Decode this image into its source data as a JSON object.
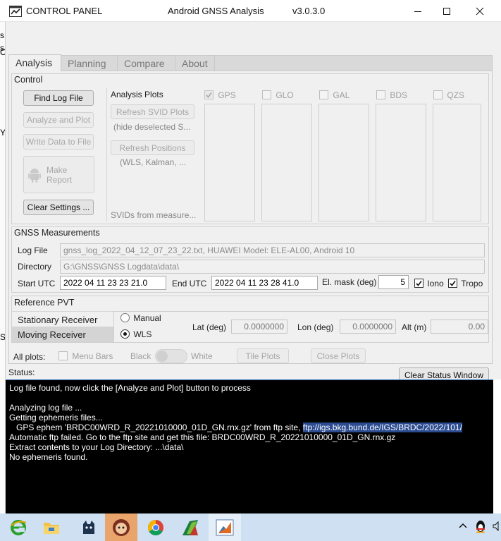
{
  "window": {
    "title_left": "CONTROL PANEL",
    "title_center": "Android GNSS Analysis",
    "version": "v3.0.3.0"
  },
  "left_strip": [
    "s,",
    "s",
    "C",
    "Y",
    "S"
  ],
  "tabs": [
    {
      "label": "Analysis",
      "active": true
    },
    {
      "label": "Planning",
      "active": false
    },
    {
      "label": "Compare",
      "active": false
    },
    {
      "label": "About",
      "active": false
    }
  ],
  "control": {
    "title": "Control",
    "find_log_file": "Find Log File",
    "analyze_and_plot": "Analyze and Plot",
    "write_data": "Write Data to File",
    "make_report": "Make Report",
    "clear_settings": "Clear Settings ...",
    "analysis_plots_title": "Analysis Plots",
    "refresh_svid": "Refresh SVID Plots",
    "hide_deselected": "(hide deselected S...",
    "refresh_positions": "Refresh Positions",
    "wls_kalman": "(WLS, Kalman, ...",
    "svids_from": "SVIDs from measure...",
    "constellations": [
      {
        "label": "GPS",
        "checked": true
      },
      {
        "label": "GLO",
        "checked": false
      },
      {
        "label": "GAL",
        "checked": false
      },
      {
        "label": "BDS",
        "checked": false
      },
      {
        "label": "QZS",
        "checked": false
      }
    ]
  },
  "gnss": {
    "title": "GNSS Measurements",
    "log_file_label": "Log File",
    "log_file_value": "gnss_log_2022_04_12_07_23_22.txt, HUAWEI Model: ELE-AL00, Android 10",
    "directory_label": "Directory",
    "directory_value": "G:\\GNSS\\GNSS Logdata\\data\\",
    "start_utc_label": "Start UTC",
    "start_utc_value": "2022 04 11 23 23 21.0",
    "end_utc_label": "End UTC",
    "end_utc_value": "2022 04 11 23 28 41.0",
    "el_mask_label": "El. mask (deg)",
    "el_mask_value": "5",
    "iono_label": "Iono",
    "iono_checked": true,
    "tropo_label": "Tropo",
    "tropo_checked": true
  },
  "pvt": {
    "title": "Reference PVT",
    "stationary": "Stationary Receiver",
    "moving": "Moving Receiver",
    "manual": "Manual",
    "wls": "WLS",
    "selected": "WLS",
    "lat_label": "Lat (deg)",
    "lat_value": "0.0000000",
    "lon_label": "Lon (deg)",
    "lon_value": "0.0000000",
    "alt_label": "Alt (m)",
    "alt_value": "0.00"
  },
  "all_plots": {
    "label": "All plots:",
    "menu_bars": "Menu Bars",
    "black": "Black",
    "white": "White",
    "tile_plots": "Tile Plots",
    "close_plots": "Close Plots"
  },
  "status": {
    "label": "Status:",
    "clear_button": "Clear Status Window",
    "lines": [
      "Log file found, now click the [Analyze and Plot] button to process",
      "",
      "Analyzing log file ...",
      "Getting ephemeris files...",
      "   GPS ephem 'BRDC00WRD_R_20221010000_01D_GN.rnx.gz' from ftp site, ",
      "Automatic ftp failed. Go to the ftp site and get this file: BRDC00WRD_R_20221010000_01D_GN.rnx.gz",
      "Extract contents to your Log Directory: ...\\data\\",
      "No ephemeris found."
    ],
    "ftp_link": "ftp://igs.bkg.bund.de/IGS/BRDC/2022/101/"
  },
  "taskbar": {
    "apps": [
      "ie-icon",
      "file-explorer-icon",
      "cat-app-icon",
      "avatar-app-icon",
      "chrome-icon",
      "excel-icon",
      "matlab-icon"
    ],
    "tray": [
      "chevron-up-icon",
      "qq-penguin-icon",
      "speaker-icon"
    ]
  }
}
